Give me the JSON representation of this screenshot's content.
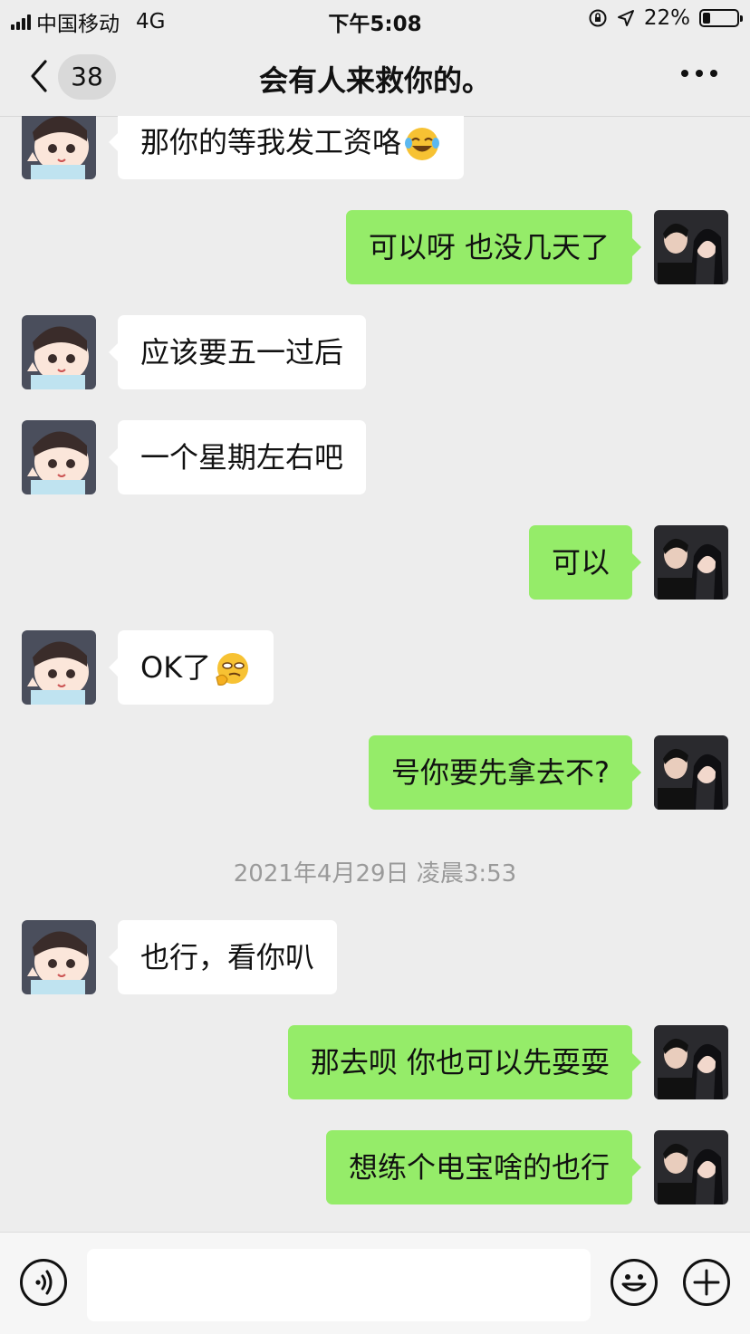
{
  "status_bar": {
    "carrier": "中国移动",
    "network": "4G",
    "time": "下午5:08",
    "battery_percent": "22%",
    "battery_level": 0.22
  },
  "nav": {
    "unread_count": "38",
    "title": "会有人来救你的。",
    "back_icon": "chevron-left-icon",
    "more_icon": "more-dots-icon"
  },
  "colors": {
    "outgoing_bubble": "#95ec69",
    "incoming_bubble": "#ffffff",
    "background": "#ededed"
  },
  "messages": [
    {
      "side": "in",
      "text": "那你的等我发工资咯",
      "emoji": "laughing-tears-emoji"
    },
    {
      "side": "out",
      "text": "可以呀 也没几天了"
    },
    {
      "side": "in",
      "text": "应该要五一过后"
    },
    {
      "side": "in",
      "text": "一个星期左右吧"
    },
    {
      "side": "out",
      "text": "可以"
    },
    {
      "side": "in",
      "text": "OK了",
      "emoji": "thinking-emoji"
    },
    {
      "side": "out",
      "text": "号你要先拿去不?"
    },
    {
      "side": "in",
      "text": "也行，看你叭"
    },
    {
      "side": "out",
      "text": "那去呗 你也可以先耍耍"
    },
    {
      "side": "out",
      "text": "想练个电宝啥的也行"
    }
  ],
  "timestamp": "2021年4月29日 凌晨3:53",
  "input_bar": {
    "voice_icon": "voice-icon",
    "emoji_icon": "emoji-icon",
    "plus_icon": "plus-icon",
    "text_value": ""
  }
}
